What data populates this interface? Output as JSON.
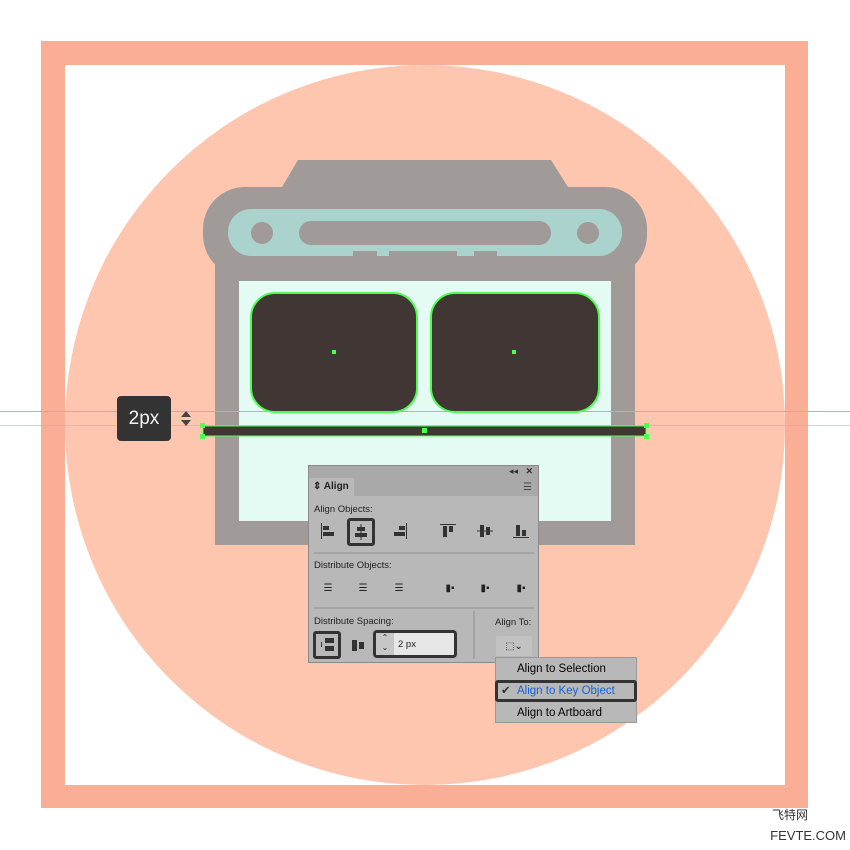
{
  "canvas": {
    "colors": {
      "frame": "#F9AE95",
      "circle": "#FEC6AF",
      "body": "#A09A99",
      "band": "#ABD3CD",
      "window": "#E4FBF4",
      "screen": "#403735",
      "selection": "#4CFF4C"
    }
  },
  "tooltip": {
    "text": "2px"
  },
  "panel": {
    "title": "Align",
    "align_objects_label": "Align Objects:",
    "distribute_objects_label": "Distribute Objects:",
    "distribute_spacing_label": "Distribute Spacing:",
    "align_to_label": "Align To:",
    "spacing_value": "2 px",
    "align_objects": [
      "horizontal-align-left",
      "horizontal-align-center",
      "horizontal-align-right",
      "vertical-align-top",
      "vertical-align-center",
      "vertical-align-bottom"
    ],
    "selected_align": "horizontal-align-center"
  },
  "dropdown": {
    "items": [
      {
        "label": "Align to Selection",
        "checked": false
      },
      {
        "label": "Align to Key Object",
        "checked": true
      },
      {
        "label": "Align to Artboard",
        "checked": false
      }
    ]
  },
  "watermark": {
    "line1": "飞特网",
    "line2": "FEVTE.COM"
  }
}
